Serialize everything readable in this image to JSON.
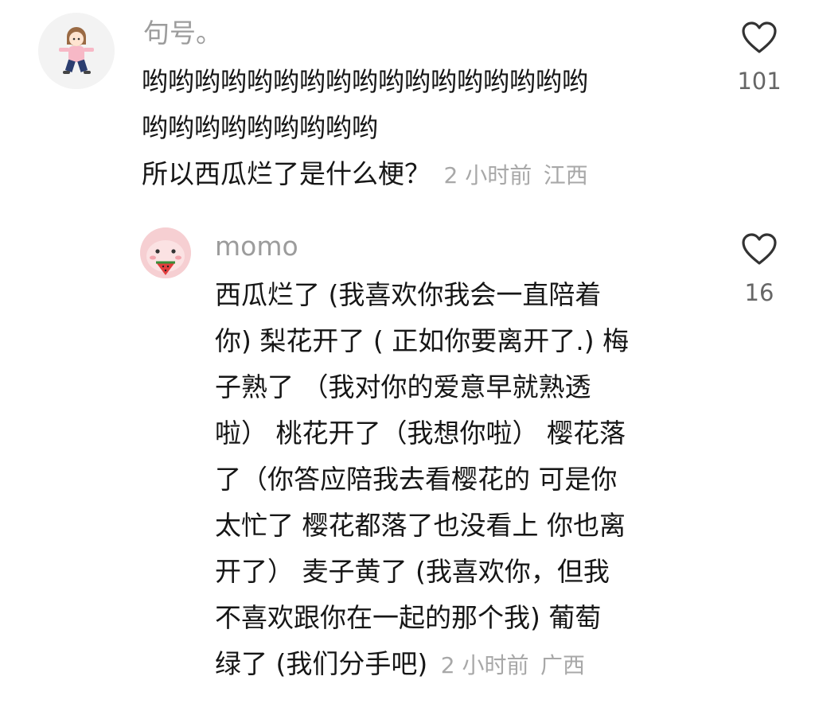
{
  "comments": [
    {
      "username": "句号。",
      "lines": [
        "哟哟哟哟哟哟哟哟哟哟哟哟哟哟哟哟哟",
        "哟哟哟哟哟哟哟哟哟",
        "所以西瓜烂了是什么梗？"
      ],
      "time": "2 小时前",
      "location": "江西",
      "likes": "101",
      "like_icon": "heart-outline-icon"
    },
    {
      "username": "momo",
      "lines": [
        "西瓜烂了 (我喜欢你我会一直陪着",
        "你) 梨花开了 ( 正如你要离开了.) 梅",
        "子熟了 （我对你的爱意早就熟透",
        "啦）  桃花开了（我想你啦） 樱花落",
        "了（你答应陪我去看樱花的 可是你",
        "太忙了 樱花都落了也没看上 你也离",
        "开了）  麦子黄了 (我喜欢你，但我",
        "不喜欢跟你在一起的那个我) 葡萄",
        "绿了 (我们分手吧)"
      ],
      "time": "2 小时前",
      "location": "广西",
      "likes": "16",
      "like_icon": "heart-outline-icon"
    }
  ]
}
